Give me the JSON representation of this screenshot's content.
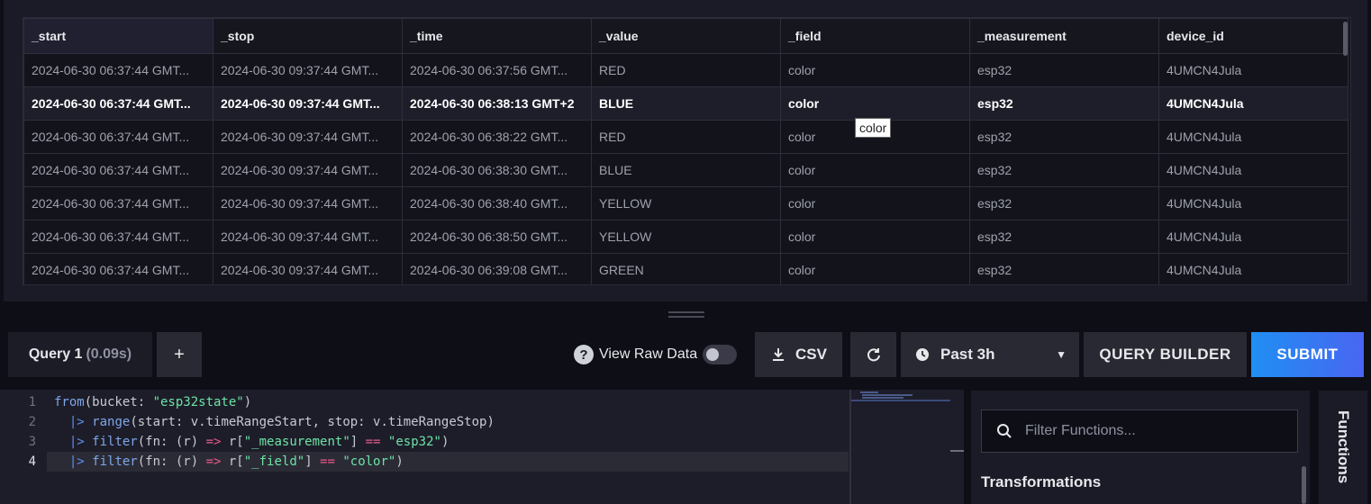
{
  "table": {
    "columns": [
      "_start",
      "_stop",
      "_time",
      "_value",
      "_field",
      "_measurement",
      "device_id"
    ],
    "rows": [
      [
        "2024-06-30 06:37:44 GMT...",
        "2024-06-30 09:37:44 GMT...",
        "2024-06-30 06:37:56 GMT...",
        "RED",
        "color",
        "esp32",
        "4UMCN4Jula"
      ],
      [
        "2024-06-30 06:37:44 GMT...",
        "2024-06-30 09:37:44 GMT...",
        "2024-06-30 06:38:13 GMT+2",
        "BLUE",
        "color",
        "esp32",
        "4UMCN4Jula"
      ],
      [
        "2024-06-30 06:37:44 GMT...",
        "2024-06-30 09:37:44 GMT...",
        "2024-06-30 06:38:22 GMT...",
        "RED",
        "color",
        "esp32",
        "4UMCN4Jula"
      ],
      [
        "2024-06-30 06:37:44 GMT...",
        "2024-06-30 09:37:44 GMT...",
        "2024-06-30 06:38:30 GMT...",
        "BLUE",
        "color",
        "esp32",
        "4UMCN4Jula"
      ],
      [
        "2024-06-30 06:37:44 GMT...",
        "2024-06-30 09:37:44 GMT...",
        "2024-06-30 06:38:40 GMT...",
        "YELLOW",
        "color",
        "esp32",
        "4UMCN4Jula"
      ],
      [
        "2024-06-30 06:37:44 GMT...",
        "2024-06-30 09:37:44 GMT...",
        "2024-06-30 06:38:50 GMT...",
        "YELLOW",
        "color",
        "esp32",
        "4UMCN4Jula"
      ],
      [
        "2024-06-30 06:37:44 GMT...",
        "2024-06-30 09:37:44 GMT...",
        "2024-06-30 06:39:08 GMT...",
        "GREEN",
        "color",
        "esp32",
        "4UMCN4Jula"
      ]
    ],
    "tooltip": "color"
  },
  "toolbar": {
    "query_tab_label": "Query 1",
    "query_tab_time": "(0.09s)",
    "add_query": "+",
    "help_glyph": "?",
    "view_raw_label": "View Raw Data",
    "view_raw_on": false,
    "csv_label": "CSV",
    "time_range": "Past 3h",
    "query_builder_label": "QUERY BUILDER",
    "submit_label": "SUBMIT"
  },
  "editor": {
    "line_numbers": [
      "1",
      "2",
      "3",
      "4"
    ],
    "current_line": 4
  },
  "functions": {
    "search_placeholder": "Filter Functions...",
    "section": "Transformations",
    "tab_label": "Functions"
  },
  "colors": {
    "background": "#0e0e16",
    "panel": "#1b1b27",
    "submit_start": "#1f8ff2",
    "submit_end": "#4966f2",
    "string": "#6de3a5",
    "operator": "#e85b8a",
    "keyword": "#7ea6e8"
  },
  "icons": {
    "csv": "download-icon",
    "refresh": "refresh-icon",
    "time": "clock-icon",
    "dropdown": "caret-down-icon",
    "search": "search-icon"
  }
}
